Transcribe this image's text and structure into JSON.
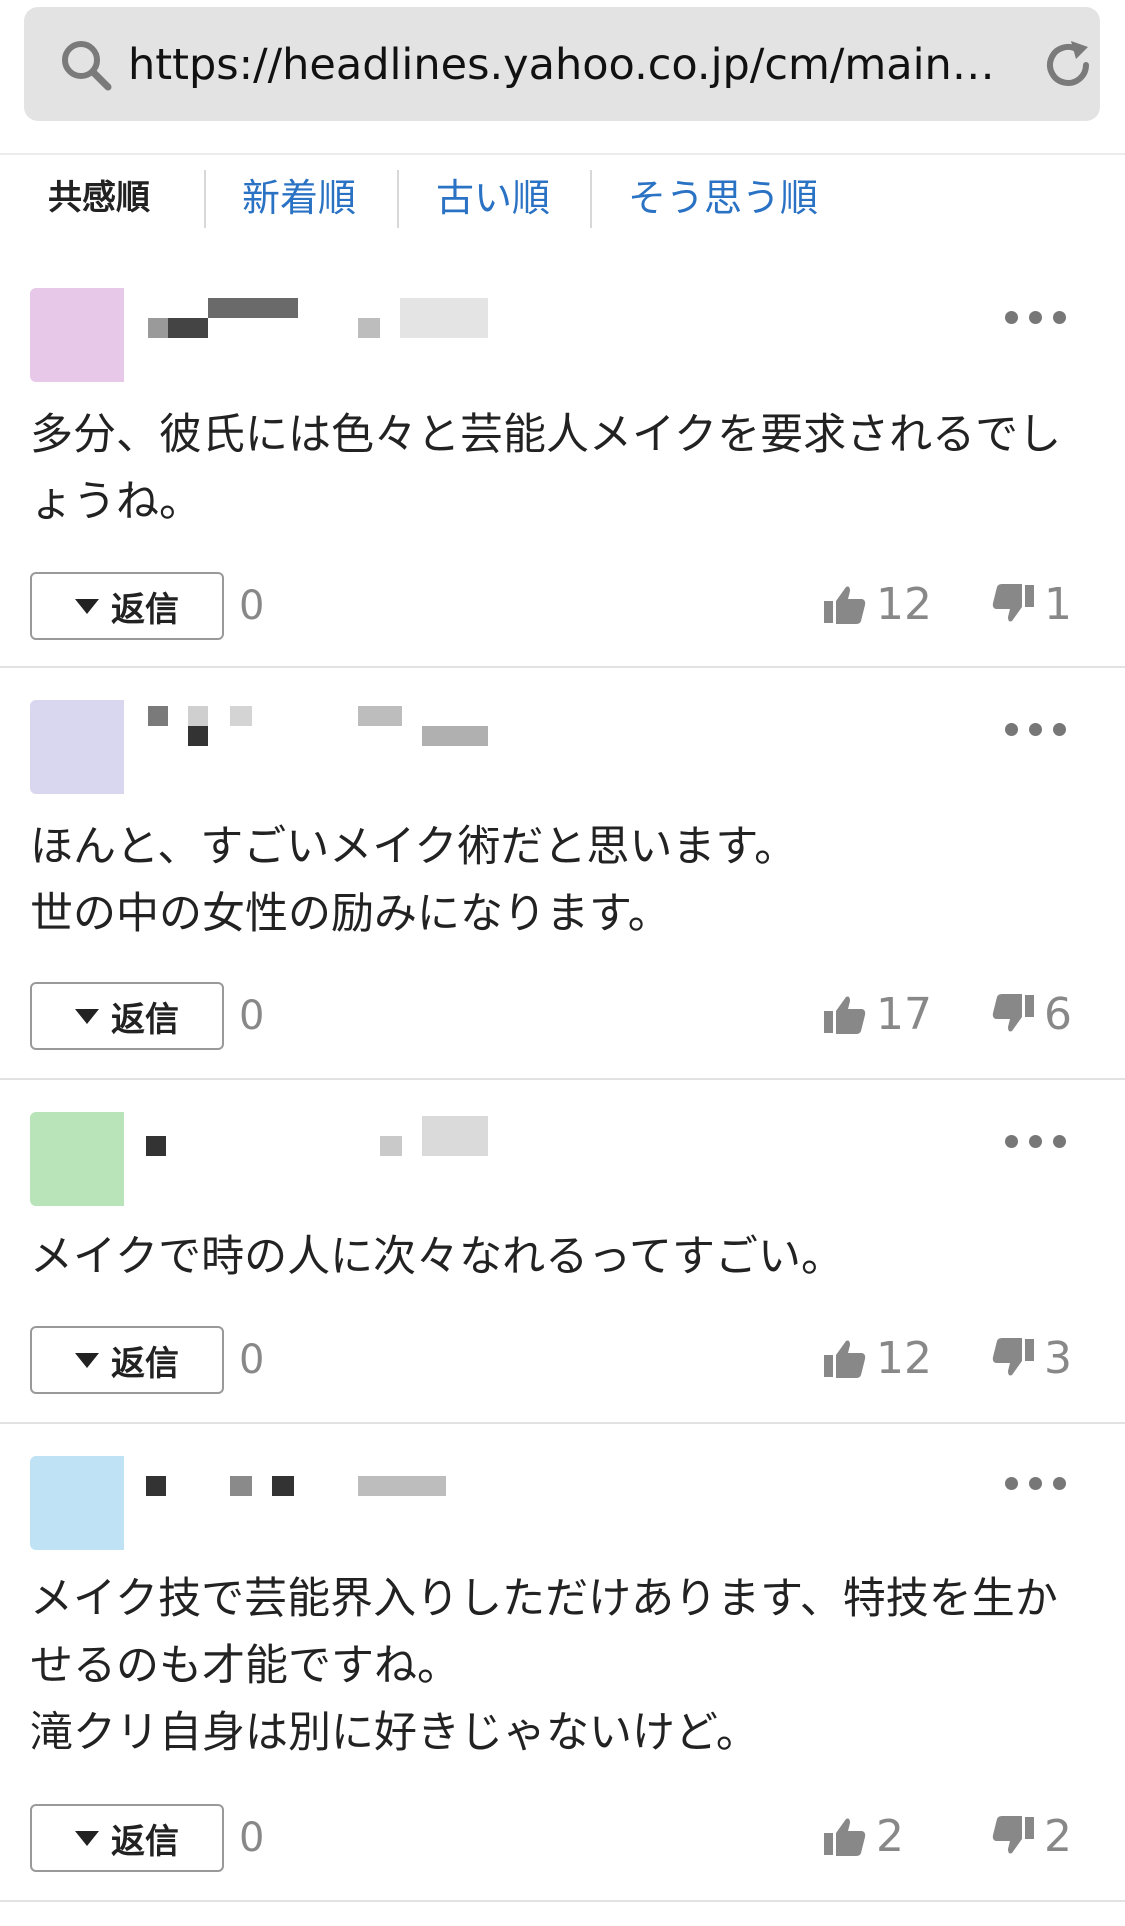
{
  "browser": {
    "url": "https://headlines.yahoo.co.jp/cm/main?…"
  },
  "sort_tabs": [
    {
      "label": "共感順",
      "active": true
    },
    {
      "label": "新着順",
      "active": false
    },
    {
      "label": "古い順",
      "active": false
    },
    {
      "label": "そう思う順",
      "active": false
    }
  ],
  "comments": [
    {
      "avatar_color": "#e8c8e8",
      "text": "多分、彼氏には色々と芸能人メイクを要求されるでしょうね。",
      "reply_label": "返信",
      "reply_count": "0",
      "likes": "12",
      "dislikes": "1"
    },
    {
      "avatar_color": "#d9d7f0",
      "text": "ほんと、すごいメイク術だと思います。\n世の中の女性の励みになります。",
      "reply_label": "返信",
      "reply_count": "0",
      "likes": "17",
      "dislikes": "6"
    },
    {
      "avatar_color": "#b9e3b9",
      "text": "メイクで時の人に次々なれるってすごい。",
      "reply_label": "返信",
      "reply_count": "0",
      "likes": "12",
      "dislikes": "3"
    },
    {
      "avatar_color": "#bfe3f5",
      "text": "メイク技で芸能界入りしただけあります、特技を生かせるのも才能ですね。\n滝クリ自身は別に好きじゃないけど。",
      "reply_label": "返信",
      "reply_count": "0",
      "likes": "2",
      "dislikes": "2"
    }
  ]
}
